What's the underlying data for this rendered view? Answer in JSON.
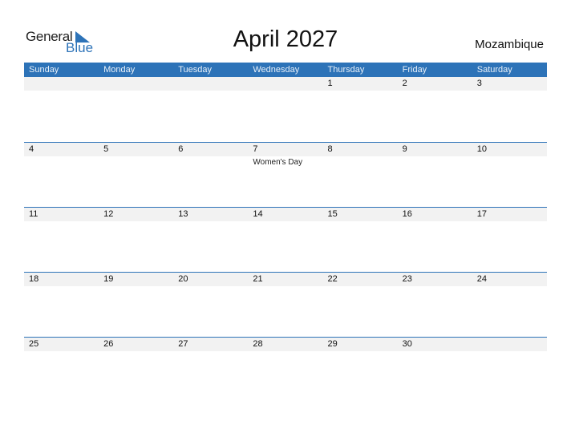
{
  "logo": {
    "line1": "General",
    "line2": "Blue",
    "icon": "blue-triangle-flag-icon"
  },
  "title": "April 2027",
  "country": "Mozambique",
  "colors": {
    "accent": "#2d73b8",
    "date_band": "#f2f2f2"
  },
  "weekdays": [
    "Sunday",
    "Monday",
    "Tuesday",
    "Wednesday",
    "Thursday",
    "Friday",
    "Saturday"
  ],
  "weeks": [
    {
      "days": [
        "",
        "",
        "",
        "",
        "1",
        "2",
        "3"
      ],
      "events": [
        "",
        "",
        "",
        "",
        "",
        "",
        ""
      ]
    },
    {
      "days": [
        "4",
        "5",
        "6",
        "7",
        "8",
        "9",
        "10"
      ],
      "events": [
        "",
        "",
        "",
        "Women's Day",
        "",
        "",
        ""
      ]
    },
    {
      "days": [
        "11",
        "12",
        "13",
        "14",
        "15",
        "16",
        "17"
      ],
      "events": [
        "",
        "",
        "",
        "",
        "",
        "",
        ""
      ]
    },
    {
      "days": [
        "18",
        "19",
        "20",
        "21",
        "22",
        "23",
        "24"
      ],
      "events": [
        "",
        "",
        "",
        "",
        "",
        "",
        ""
      ]
    },
    {
      "days": [
        "25",
        "26",
        "27",
        "28",
        "29",
        "30",
        ""
      ],
      "events": [
        "",
        "",
        "",
        "",
        "",
        "",
        ""
      ]
    }
  ]
}
